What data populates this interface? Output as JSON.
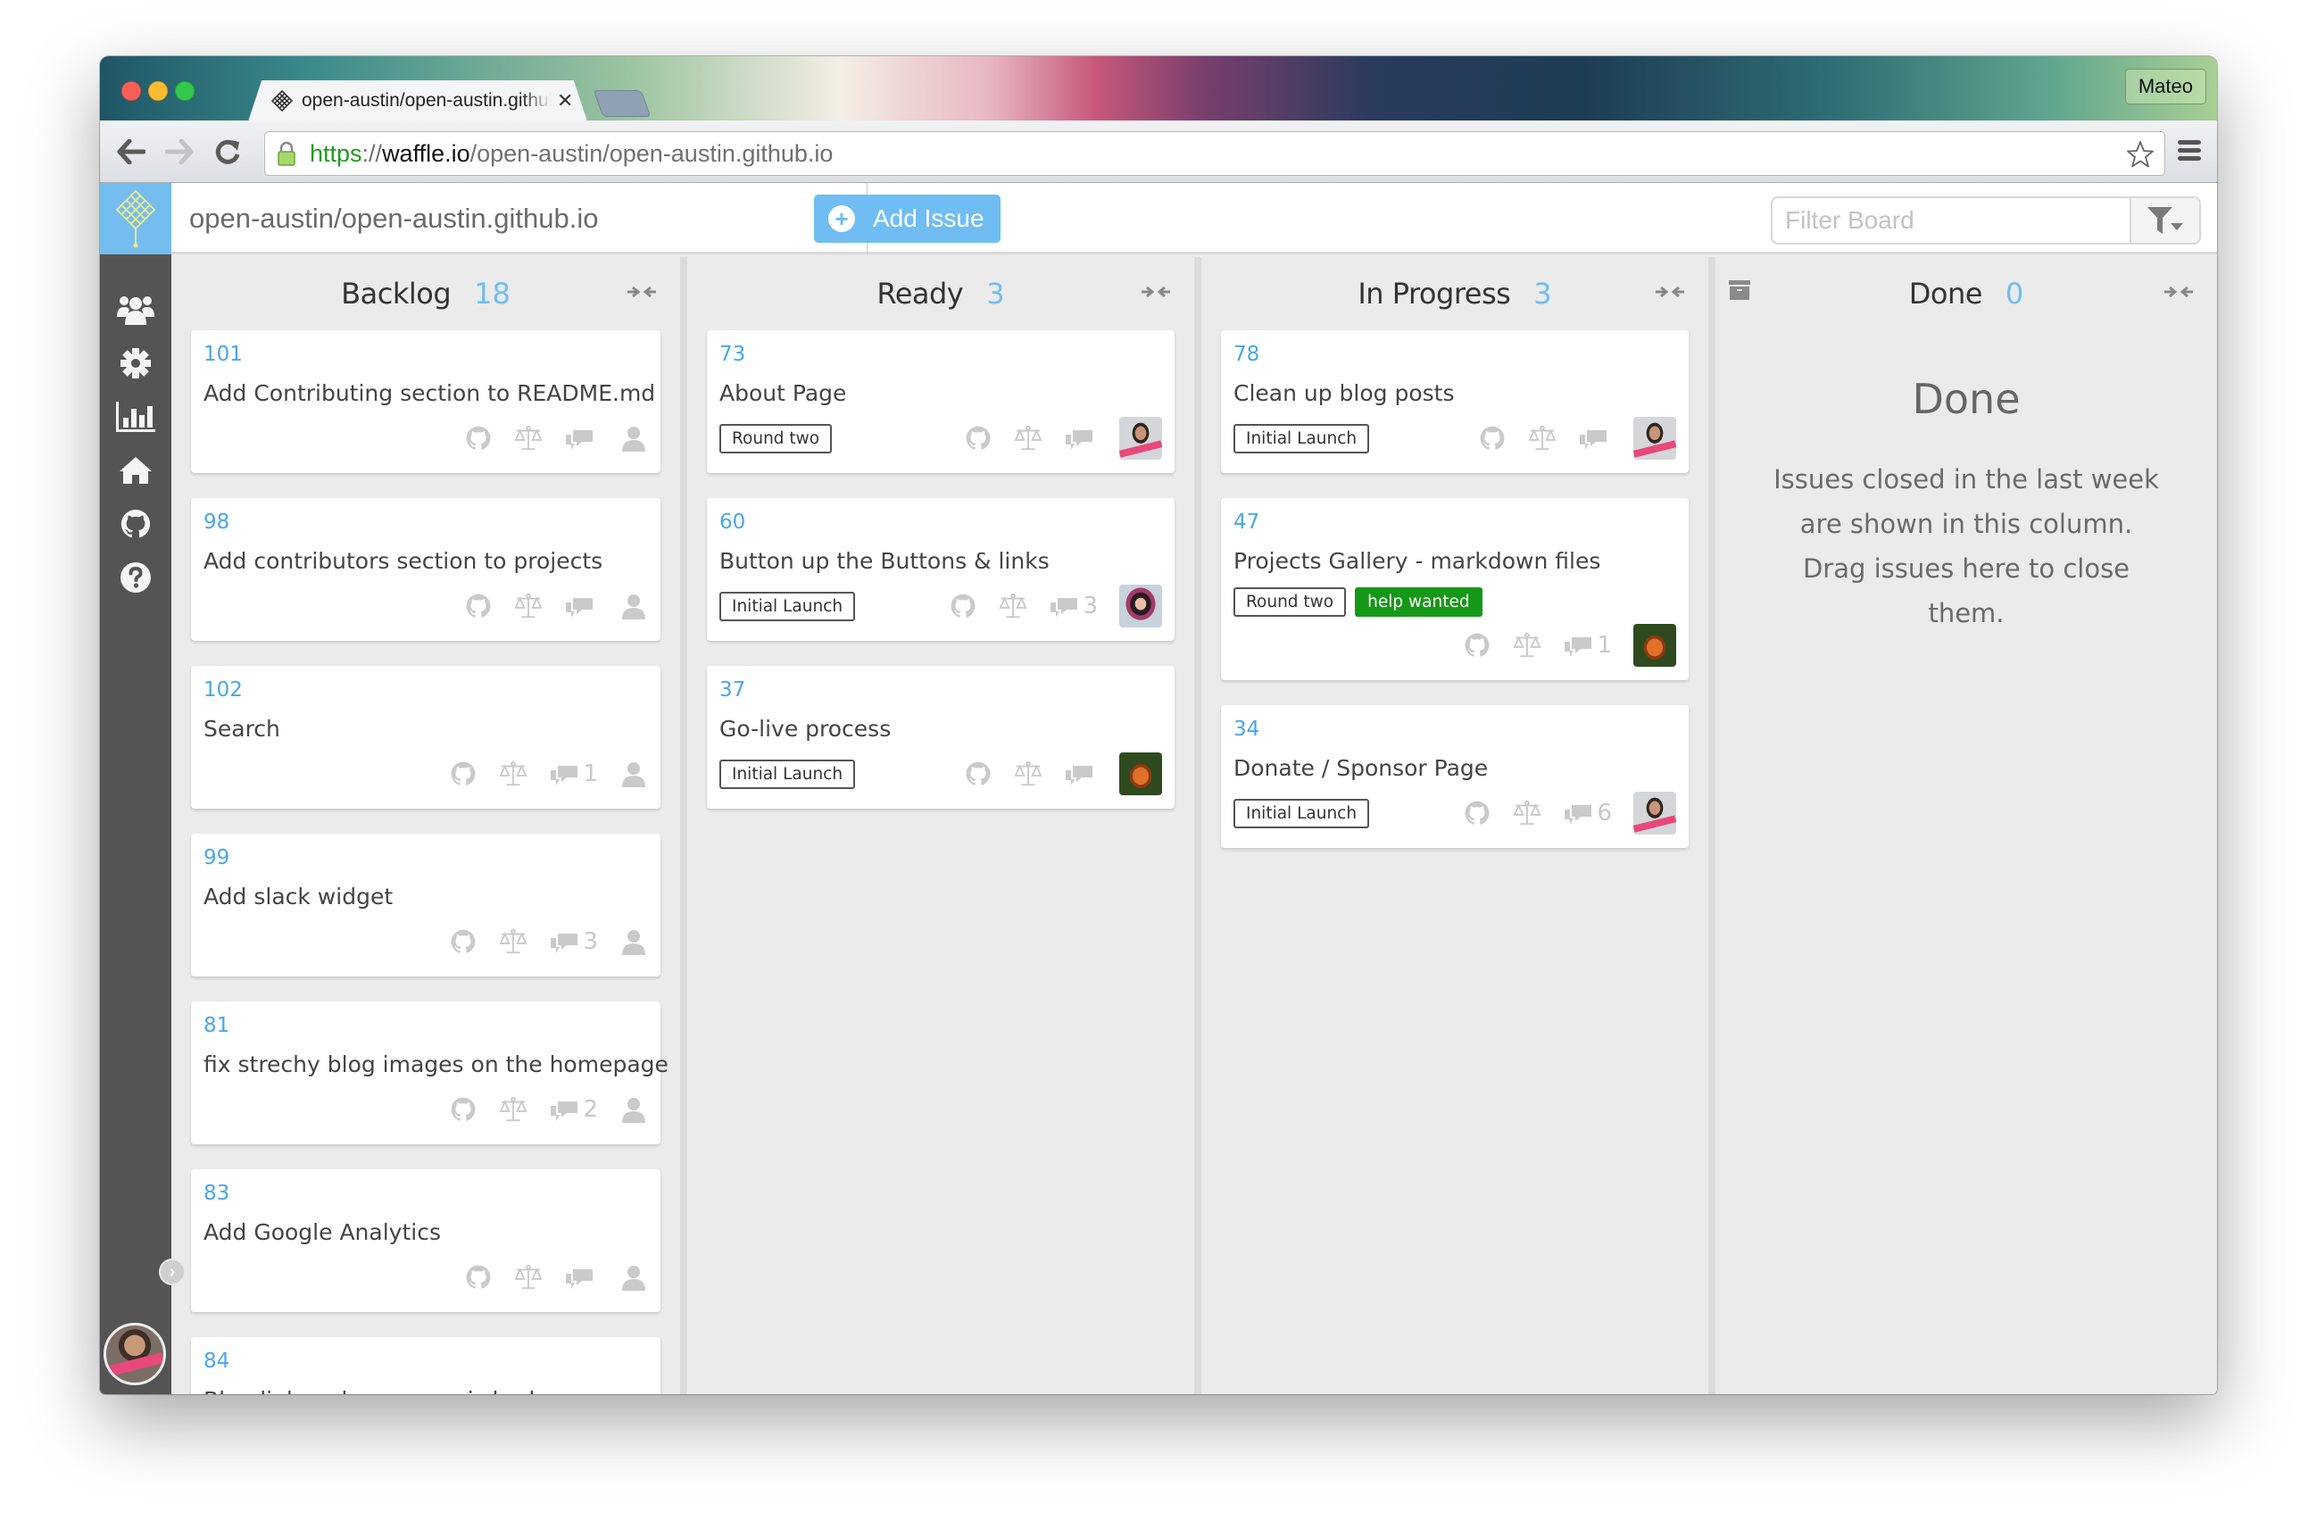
{
  "browser": {
    "tab_title": "open-austin/open-austin.github.io",
    "profile_name": "Mateo",
    "url": {
      "scheme": "https",
      "separator": "://",
      "host": "waffle.io",
      "path": "/open-austin/open-austin.github.io"
    }
  },
  "header": {
    "repo": "open-austin/open-austin.github.io",
    "add_issue_label": "Add Issue",
    "filter_placeholder": "Filter Board",
    "filter_value": ""
  },
  "sidebar": {
    "items": [
      {
        "name": "team",
        "icon": "users-icon"
      },
      {
        "name": "settings",
        "icon": "gear-icon"
      },
      {
        "name": "metrics",
        "icon": "bar-chart-icon"
      },
      {
        "name": "home",
        "icon": "home-icon"
      },
      {
        "name": "github",
        "icon": "github-icon"
      },
      {
        "name": "help",
        "icon": "question-icon"
      }
    ]
  },
  "colors": {
    "accent": "#6fbdf2",
    "issue_number": "#4aa6ea",
    "help_wanted": "#159818",
    "sidebar": "#545454"
  },
  "columns": [
    {
      "title": "Backlog",
      "count": "18",
      "cards": [
        {
          "number": "101",
          "title": "Add Contributing section to README.md",
          "labels": [],
          "comments": "",
          "assignee": null
        },
        {
          "number": "98",
          "title": "Add contributors section to projects",
          "labels": [],
          "comments": "",
          "assignee": null
        },
        {
          "number": "102",
          "title": "Search",
          "labels": [],
          "comments": "1",
          "assignee": null
        },
        {
          "number": "99",
          "title": "Add slack widget",
          "labels": [],
          "comments": "3",
          "assignee": null
        },
        {
          "number": "81",
          "title": "fix strechy blog images on the homepage",
          "labels": [],
          "comments": "2",
          "assignee": null
        },
        {
          "number": "83",
          "title": "Add Google Analytics",
          "labels": [],
          "comments": "",
          "assignee": null
        },
        {
          "number": "84",
          "title": "Blog link on homepage is broken",
          "labels": [],
          "comments": "",
          "assignee": null
        }
      ]
    },
    {
      "title": "Ready",
      "count": "3",
      "cards": [
        {
          "number": "73",
          "title": "About Page",
          "labels": [
            {
              "text": "Round two",
              "style": "outline"
            }
          ],
          "comments": "",
          "assignee": "man"
        },
        {
          "number": "60",
          "title": "Button up the Buttons & links",
          "labels": [
            {
              "text": "Initial Launch",
              "style": "outline"
            }
          ],
          "comments": "3",
          "assignee": "woman"
        },
        {
          "number": "37",
          "title": "Go-live process",
          "labels": [
            {
              "text": "Initial Launch",
              "style": "outline"
            }
          ],
          "comments": "",
          "assignee": "squirrel"
        }
      ]
    },
    {
      "title": "In Progress",
      "count": "3",
      "cards": [
        {
          "number": "78",
          "title": "Clean up blog posts",
          "labels": [
            {
              "text": "Initial Launch",
              "style": "outline"
            }
          ],
          "comments": "",
          "assignee": "man"
        },
        {
          "number": "47",
          "title": "Projects Gallery - markdown files",
          "labels": [
            {
              "text": "Round two",
              "style": "outline"
            },
            {
              "text": "help wanted",
              "style": "green"
            }
          ],
          "comments": "1",
          "assignee": "squirrel"
        },
        {
          "number": "34",
          "title": "Donate / Sponsor Page",
          "labels": [
            {
              "text": "Initial Launch",
              "style": "outline"
            }
          ],
          "comments": "6",
          "assignee": "man"
        }
      ]
    },
    {
      "title": "Done",
      "count": "0",
      "empty_title": "Done",
      "empty_text": "Issues closed in the last week are shown in this column. Drag issues here to close them.",
      "cards": []
    }
  ]
}
